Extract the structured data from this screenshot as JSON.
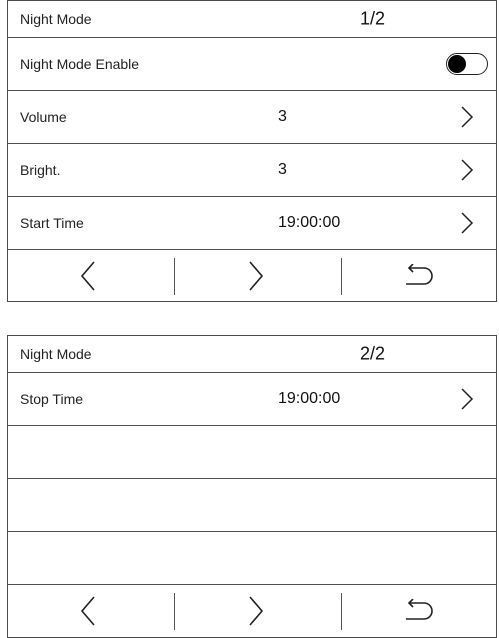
{
  "screen1": {
    "title": "Night Mode",
    "page_indicator": "1/2",
    "rows": {
      "enable": {
        "label": "Night Mode Enable",
        "toggle_on": true
      },
      "volume": {
        "label": "Volume",
        "value": "3"
      },
      "bright": {
        "label": "Bright.",
        "value": "3"
      },
      "start_time": {
        "label": "Start Time",
        "value": "19:00:00"
      }
    }
  },
  "screen2": {
    "title": "Night Mode",
    "page_indicator": "2/2",
    "rows": {
      "stop_time": {
        "label": "Stop Time",
        "value": "19:00:00"
      }
    }
  },
  "icons": {
    "row_arrow": "chevron-right-icon",
    "prev": "chevron-left-icon",
    "next": "chevron-right-icon",
    "back": "return-arrow-icon"
  }
}
